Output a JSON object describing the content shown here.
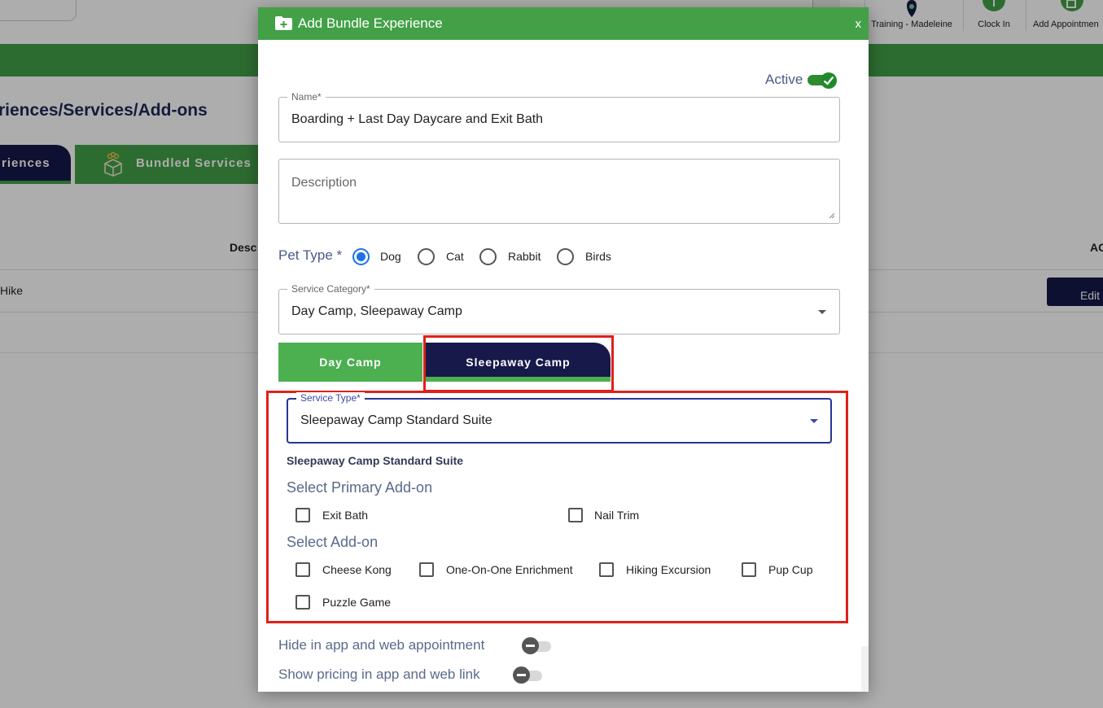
{
  "background": {
    "header_buttons": [
      {
        "label": "Training - Madeleine",
        "icon": "location-pin-icon"
      },
      {
        "label": "Clock In",
        "icon": "clock-icon"
      },
      {
        "label": "Add Appointmen",
        "icon": "add-appointment-icon"
      }
    ],
    "page_title": "riences/Services/Add-ons",
    "tabs": [
      {
        "label": "riences"
      },
      {
        "label": "Bundled Services",
        "icon": "gift-box-icon"
      }
    ],
    "table": {
      "columns": [
        "Desc",
        "AC"
      ],
      "rows": [
        {
          "name": "Hike",
          "action": "Edit"
        }
      ]
    }
  },
  "modal": {
    "title": "Add Bundle Experience",
    "close_label": "x",
    "active": {
      "label": "Active",
      "value": true
    },
    "name": {
      "label": "Name*",
      "value": "Boarding + Last Day Daycare and Exit Bath"
    },
    "description": {
      "placeholder": "Description"
    },
    "pet_type": {
      "label": "Pet Type *",
      "options": [
        "Dog",
        "Cat",
        "Rabbit",
        "Birds"
      ],
      "selected": "Dog"
    },
    "service_category": {
      "label": "Service Category*",
      "value": "Day Camp, Sleepaway Camp"
    },
    "category_tabs": [
      {
        "label": "Day Camp",
        "active": false
      },
      {
        "label": "Sleepaway Camp",
        "active": true
      }
    ],
    "service_type": {
      "label": "Service Type*",
      "value": "Sleepaway Camp Standard Suite"
    },
    "suite_title": "Sleepaway Camp Standard Suite",
    "primary_addon": {
      "label": "Select Primary Add-on",
      "options": [
        "Exit Bath",
        "Nail Trim"
      ]
    },
    "addon": {
      "label": "Select Add-on",
      "options": [
        "Cheese Kong",
        "One-On-One Enrichment",
        "Hiking Excursion",
        "Pup Cup",
        "Puzzle Game"
      ]
    },
    "toggles": [
      {
        "label": "Hide in app and web appointment",
        "value": false
      },
      {
        "label": "Show pricing in app and web link",
        "value": false
      }
    ]
  },
  "colors": {
    "brand_green": "#43a047",
    "navy": "#16194a",
    "highlight_red": "#e0201a",
    "radio_blue": "#1a73e8"
  }
}
